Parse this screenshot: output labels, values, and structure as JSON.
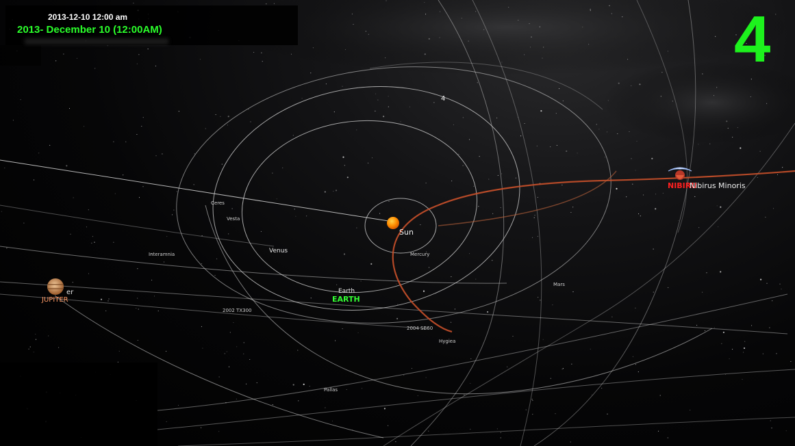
{
  "date": {
    "small": "2013-12-10 12:00 am",
    "big": "2013- December 10  (12:00AM)"
  },
  "frame_number": "4",
  "marker": "4",
  "labels": {
    "sun": "Sun",
    "mercury": "Mercury",
    "venus": "Venus",
    "earth": "Earth",
    "earth_caps": "EARTH",
    "mars": "Mars",
    "ceres": "Ceres",
    "vesta": "Vesta",
    "interamnia": "Interamnia",
    "tx300": "2002 TX300",
    "sb60": "2004 SB60",
    "hygiea": "Hygiea",
    "pallas": "Pallas",
    "jupiter_caps": "JUPITER",
    "jupiter_partial": "er",
    "nibiru_red": "NIBIRU",
    "nibiru_minoris": "Nibirus Minoris"
  },
  "colors": {
    "date_green": "#2bff2b",
    "frame_green": "#1df21d",
    "orbit": "#d8d8d8",
    "nibiru_path": "#c8502a",
    "sun": "#ff8c00",
    "nibiru_label": "#ff2020"
  },
  "icons": [
    "sun-icon",
    "jupiter-icon",
    "nibiru-icon"
  ]
}
